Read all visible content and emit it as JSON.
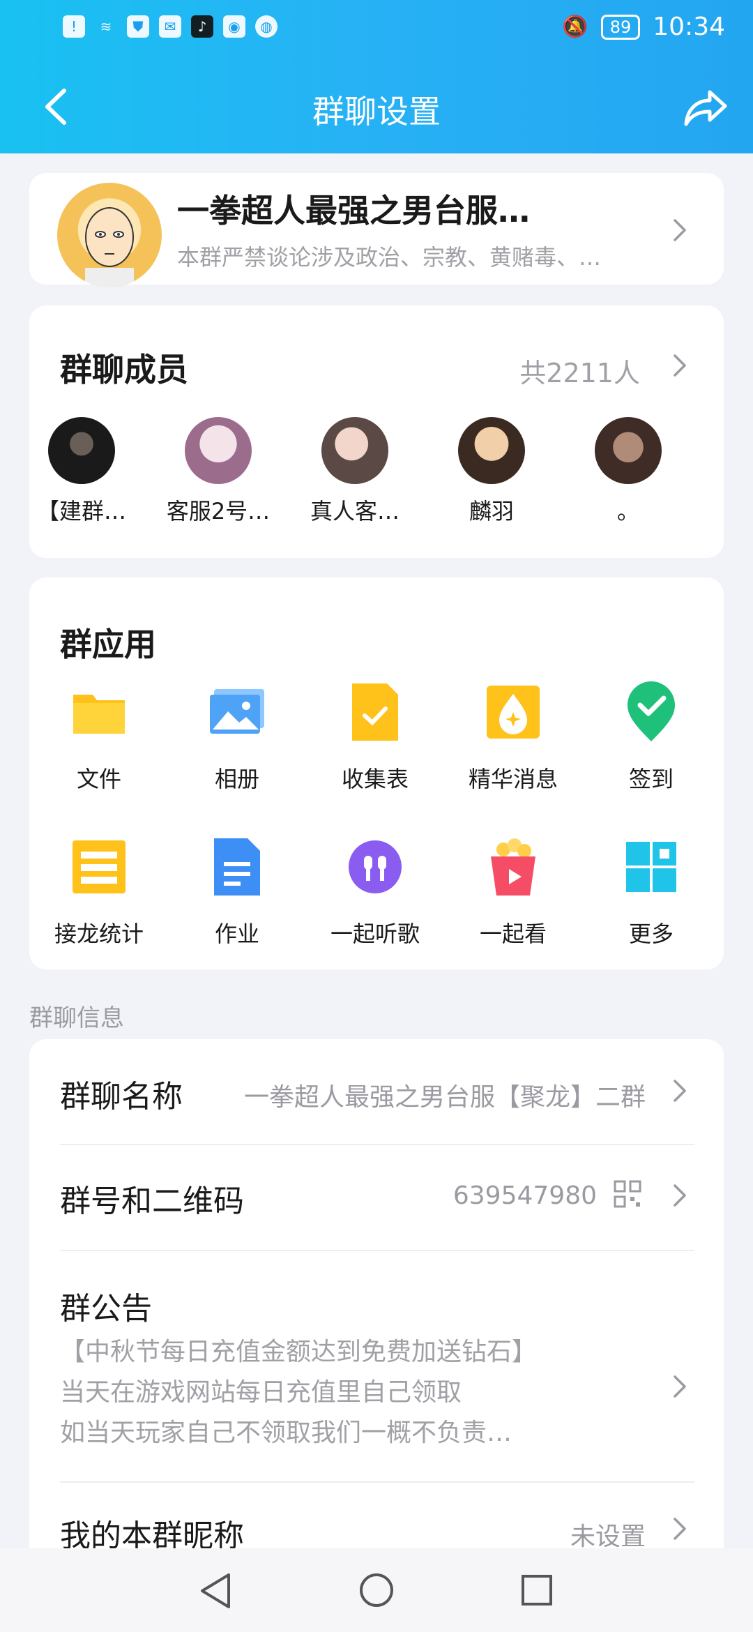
{
  "status_bar": {
    "time": "10:34",
    "battery": "89"
  },
  "nav": {
    "title": "群聊设置"
  },
  "group": {
    "name": "一拳超人最强之男台服…",
    "description": "本群严禁谈论涉及政治、宗教、黄赌毒、…"
  },
  "members": {
    "title": "群聊成员",
    "count": "共2211人",
    "items": [
      {
        "name": "【建群…"
      },
      {
        "name": "客服2号…"
      },
      {
        "name": "真人客…"
      },
      {
        "name": "麟羽"
      },
      {
        "name": "。"
      }
    ]
  },
  "apps": {
    "title": "群应用",
    "items": [
      {
        "label": "文件",
        "icon": "folder-icon"
      },
      {
        "label": "相册",
        "icon": "photo-album-icon"
      },
      {
        "label": "收集表",
        "icon": "form-icon"
      },
      {
        "label": "精华消息",
        "icon": "essence-icon"
      },
      {
        "label": "签到",
        "icon": "check-in-icon"
      },
      {
        "label": "接龙统计",
        "icon": "relay-icon"
      },
      {
        "label": "作业",
        "icon": "homework-icon"
      },
      {
        "label": "一起听歌",
        "icon": "listen-music-icon"
      },
      {
        "label": "一起看",
        "icon": "watch-together-icon"
      },
      {
        "label": "更多",
        "icon": "more-apps-icon"
      }
    ]
  },
  "info": {
    "section_label": "群聊信息",
    "group_name_label": "群聊名称",
    "group_name_value": "一拳超人最强之男台服【聚龙】二群",
    "group_id_label": "群号和二维码",
    "group_id_value": "639547980",
    "notice_label": "群公告",
    "notice_lines": [
      "【中秋节每日充值金额达到免费加送钻石】",
      "当天在游戏网站每日充值里自己领取",
      "如当天玩家自己不领取我们一概不负责…"
    ],
    "nickname_label": "我的本群昵称",
    "nickname_value": "未设置"
  },
  "colors": {
    "accent": "#1ab5f2",
    "card": "#ffffff",
    "bg": "#f2f3f8",
    "secondary_text": "#9a9aa2"
  }
}
